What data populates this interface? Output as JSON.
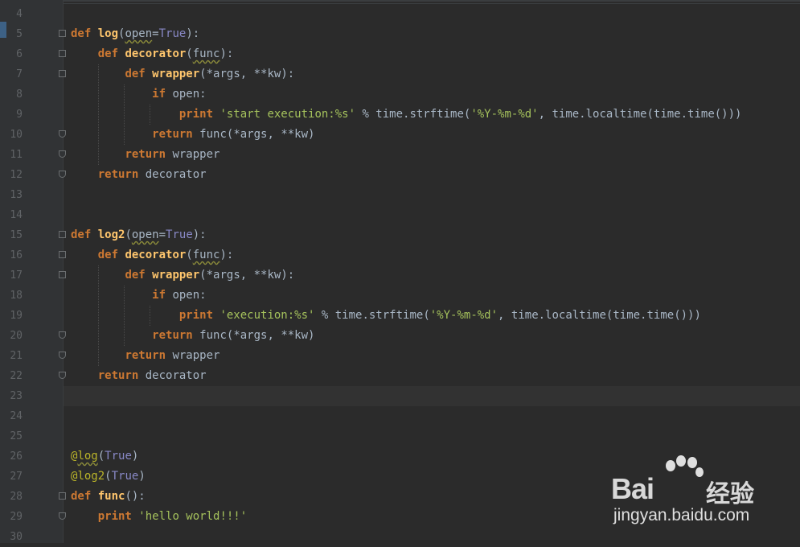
{
  "editor": {
    "lines": [
      {
        "num": "4",
        "tokens": []
      },
      {
        "num": "5",
        "tokens": [
          {
            "t": "def ",
            "c": "kw"
          },
          {
            "t": "log",
            "c": "fn"
          },
          {
            "t": "(",
            "c": ""
          },
          {
            "t": "open",
            "c": "param squig"
          },
          {
            "t": "=",
            "c": ""
          },
          {
            "t": "True",
            "c": "bi"
          },
          {
            "t": "):",
            "c": ""
          }
        ]
      },
      {
        "num": "6",
        "tokens": [
          {
            "t": "    ",
            "c": ""
          },
          {
            "t": "def ",
            "c": "kw"
          },
          {
            "t": "decorator",
            "c": "fn"
          },
          {
            "t": "(",
            "c": ""
          },
          {
            "t": "func",
            "c": "param squig"
          },
          {
            "t": "):",
            "c": ""
          }
        ]
      },
      {
        "num": "7",
        "tokens": [
          {
            "t": "        ",
            "c": ""
          },
          {
            "t": "def ",
            "c": "kw"
          },
          {
            "t": "wrapper",
            "c": "fn"
          },
          {
            "t": "(*args, **kw):",
            "c": ""
          }
        ]
      },
      {
        "num": "8",
        "tokens": [
          {
            "t": "            ",
            "c": ""
          },
          {
            "t": "if ",
            "c": "kw"
          },
          {
            "t": "open:",
            "c": ""
          }
        ]
      },
      {
        "num": "9",
        "tokens": [
          {
            "t": "                ",
            "c": ""
          },
          {
            "t": "print ",
            "c": "kw"
          },
          {
            "t": "'start execution:%s'",
            "c": "str"
          },
          {
            "t": " % time.strftime(",
            "c": ""
          },
          {
            "t": "'%Y-%m-%d'",
            "c": "str"
          },
          {
            "t": ", time.localtime(time.time()))",
            "c": ""
          }
        ]
      },
      {
        "num": "10",
        "tokens": [
          {
            "t": "            ",
            "c": ""
          },
          {
            "t": "return ",
            "c": "kw"
          },
          {
            "t": "func(*args, **kw)",
            "c": ""
          }
        ]
      },
      {
        "num": "11",
        "tokens": [
          {
            "t": "        ",
            "c": ""
          },
          {
            "t": "return ",
            "c": "kw"
          },
          {
            "t": "wrapper",
            "c": ""
          }
        ]
      },
      {
        "num": "12",
        "tokens": [
          {
            "t": "    ",
            "c": ""
          },
          {
            "t": "return ",
            "c": "kw"
          },
          {
            "t": "decorator",
            "c": ""
          }
        ]
      },
      {
        "num": "13",
        "tokens": []
      },
      {
        "num": "14",
        "tokens": []
      },
      {
        "num": "15",
        "tokens": [
          {
            "t": "def ",
            "c": "kw"
          },
          {
            "t": "log2",
            "c": "fn"
          },
          {
            "t": "(",
            "c": ""
          },
          {
            "t": "open",
            "c": "param squig"
          },
          {
            "t": "=",
            "c": ""
          },
          {
            "t": "True",
            "c": "bi"
          },
          {
            "t": "):",
            "c": ""
          }
        ]
      },
      {
        "num": "16",
        "tokens": [
          {
            "t": "    ",
            "c": ""
          },
          {
            "t": "def ",
            "c": "kw"
          },
          {
            "t": "decorator",
            "c": "fn"
          },
          {
            "t": "(",
            "c": ""
          },
          {
            "t": "func",
            "c": "param squig"
          },
          {
            "t": "):",
            "c": ""
          }
        ]
      },
      {
        "num": "17",
        "tokens": [
          {
            "t": "        ",
            "c": ""
          },
          {
            "t": "def ",
            "c": "kw"
          },
          {
            "t": "wrapper",
            "c": "fn"
          },
          {
            "t": "(*args, **kw):",
            "c": ""
          }
        ]
      },
      {
        "num": "18",
        "tokens": [
          {
            "t": "            ",
            "c": ""
          },
          {
            "t": "if ",
            "c": "kw"
          },
          {
            "t": "open:",
            "c": ""
          }
        ]
      },
      {
        "num": "19",
        "tokens": [
          {
            "t": "                ",
            "c": ""
          },
          {
            "t": "print ",
            "c": "kw"
          },
          {
            "t": "'execution:%s'",
            "c": "str"
          },
          {
            "t": " % time.strftime(",
            "c": ""
          },
          {
            "t": "'%Y-%m-%d'",
            "c": "str"
          },
          {
            "t": ", time.localtime(time.time()))",
            "c": ""
          }
        ]
      },
      {
        "num": "20",
        "tokens": [
          {
            "t": "            ",
            "c": ""
          },
          {
            "t": "return ",
            "c": "kw"
          },
          {
            "t": "func(*args, **kw)",
            "c": ""
          }
        ]
      },
      {
        "num": "21",
        "tokens": [
          {
            "t": "        ",
            "c": ""
          },
          {
            "t": "return ",
            "c": "kw"
          },
          {
            "t": "wrapper",
            "c": ""
          }
        ]
      },
      {
        "num": "22",
        "tokens": [
          {
            "t": "    ",
            "c": ""
          },
          {
            "t": "return ",
            "c": "kw"
          },
          {
            "t": "decorator",
            "c": ""
          }
        ]
      },
      {
        "num": "23",
        "tokens": []
      },
      {
        "num": "24",
        "tokens": []
      },
      {
        "num": "25",
        "tokens": []
      },
      {
        "num": "26",
        "tokens": [
          {
            "t": "@",
            "c": "dec"
          },
          {
            "t": "log",
            "c": "dec squig"
          },
          {
            "t": "(",
            "c": ""
          },
          {
            "t": "True",
            "c": "bi"
          },
          {
            "t": ")",
            "c": ""
          }
        ]
      },
      {
        "num": "27",
        "tokens": [
          {
            "t": "@",
            "c": "dec"
          },
          {
            "t": "log2",
            "c": "dec"
          },
          {
            "t": "(",
            "c": ""
          },
          {
            "t": "True",
            "c": "bi"
          },
          {
            "t": ")",
            "c": ""
          }
        ]
      },
      {
        "num": "28",
        "tokens": [
          {
            "t": "def ",
            "c": "kw"
          },
          {
            "t": "func",
            "c": "fn"
          },
          {
            "t": "():",
            "c": ""
          }
        ]
      },
      {
        "num": "29",
        "tokens": [
          {
            "t": "    ",
            "c": ""
          },
          {
            "t": "print ",
            "c": "kw"
          },
          {
            "t": "'hello world!!!'",
            "c": "str"
          }
        ]
      },
      {
        "num": "30",
        "tokens": []
      }
    ],
    "fold_markers": {
      "5": "start",
      "6": "start",
      "7": "start",
      "10": "end",
      "11": "end",
      "12": "end",
      "15": "start",
      "16": "start",
      "17": "start",
      "20": "end",
      "21": "end",
      "22": "end",
      "28": "start",
      "29": "end"
    },
    "current_line": "23"
  },
  "watermark": {
    "brand": "Bai",
    "brand_cn": "经验",
    "url": "jingyan.baidu.com"
  },
  "colors": {
    "background": "#2b2b2b",
    "gutter": "#313335",
    "keyword": "#cc7832",
    "function": "#ffc66d",
    "string": "#a5c25c",
    "builtin": "#8888c6",
    "decorator": "#bbb529",
    "text": "#a9b7c6",
    "line_number": "#606366"
  }
}
